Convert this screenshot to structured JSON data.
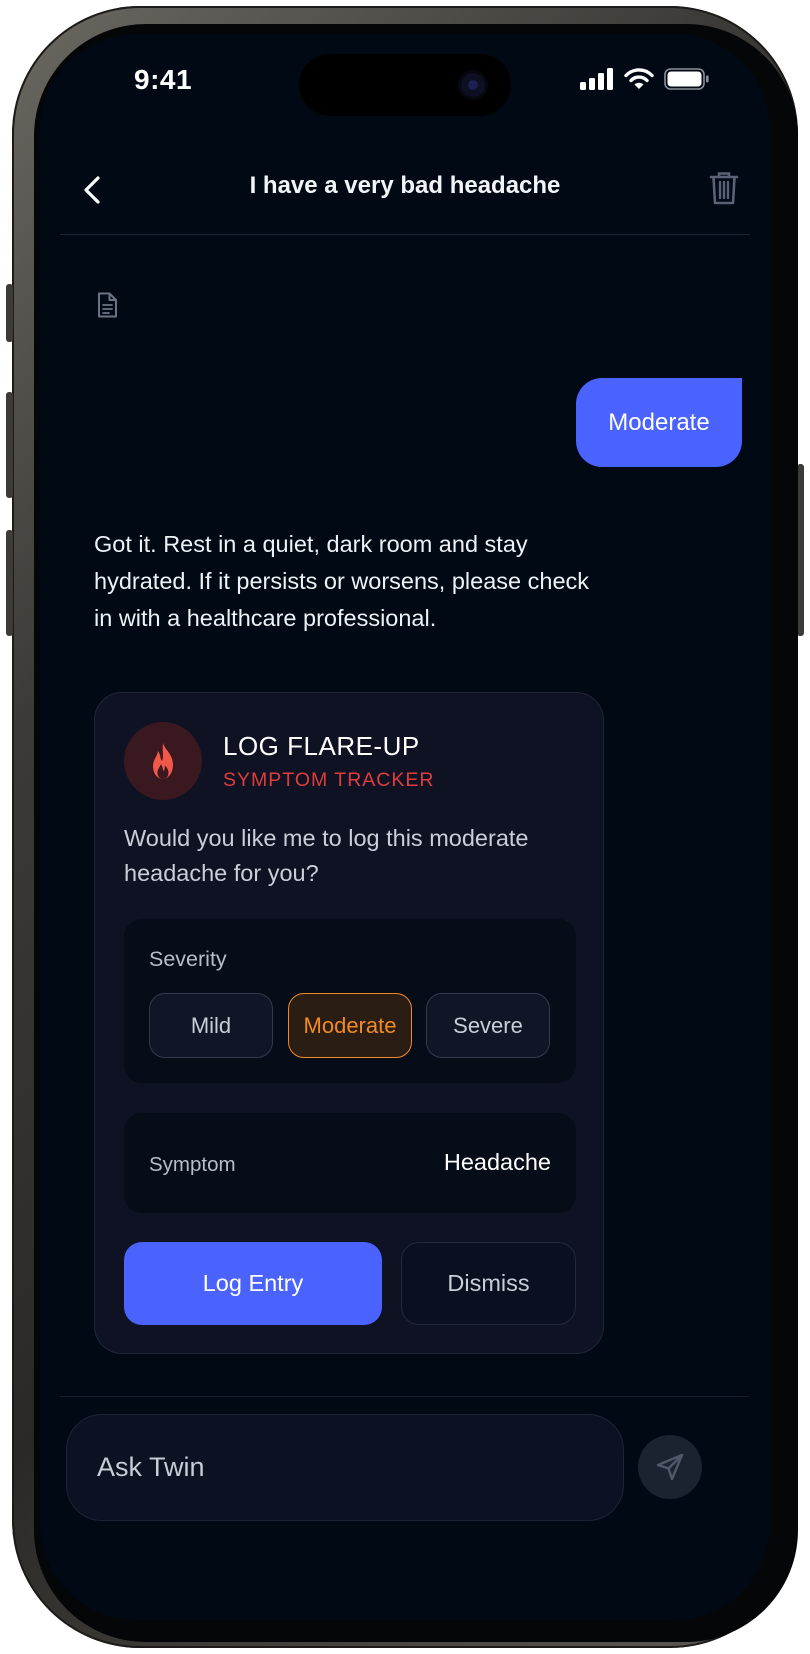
{
  "status_bar": {
    "time": "9:41"
  },
  "header": {
    "title": "I have a very bad headache"
  },
  "chat": {
    "user_message": "Moderate",
    "assistant_message": "Got it. Rest in a quiet, dark room and stay hydrated. If it persists or worsens, please check in with a healthcare professional."
  },
  "card": {
    "title": "LOG FLARE-UP",
    "subtitle": "SYMPTOM TRACKER",
    "question": "Would you like me to log this moderate headache for you?",
    "severity": {
      "label": "Severity",
      "options": [
        "Mild",
        "Moderate",
        "Severe"
      ],
      "selected": "Moderate"
    },
    "symptom": {
      "label": "Symptom",
      "value": "Headache"
    },
    "primary_action": "Log Entry",
    "secondary_action": "Dismiss"
  },
  "composer": {
    "placeholder": "Ask Twin"
  },
  "colors": {
    "background": "#010914",
    "accent": "#4a63ff",
    "flame": "#f0594a",
    "selected": "#f08a24",
    "subtitle": "#e03c3c"
  },
  "icons": [
    "back-chevron-icon",
    "trash-icon",
    "document-icon",
    "flame-icon",
    "send-icon",
    "signal-icon",
    "wifi-icon",
    "battery-icon"
  ]
}
